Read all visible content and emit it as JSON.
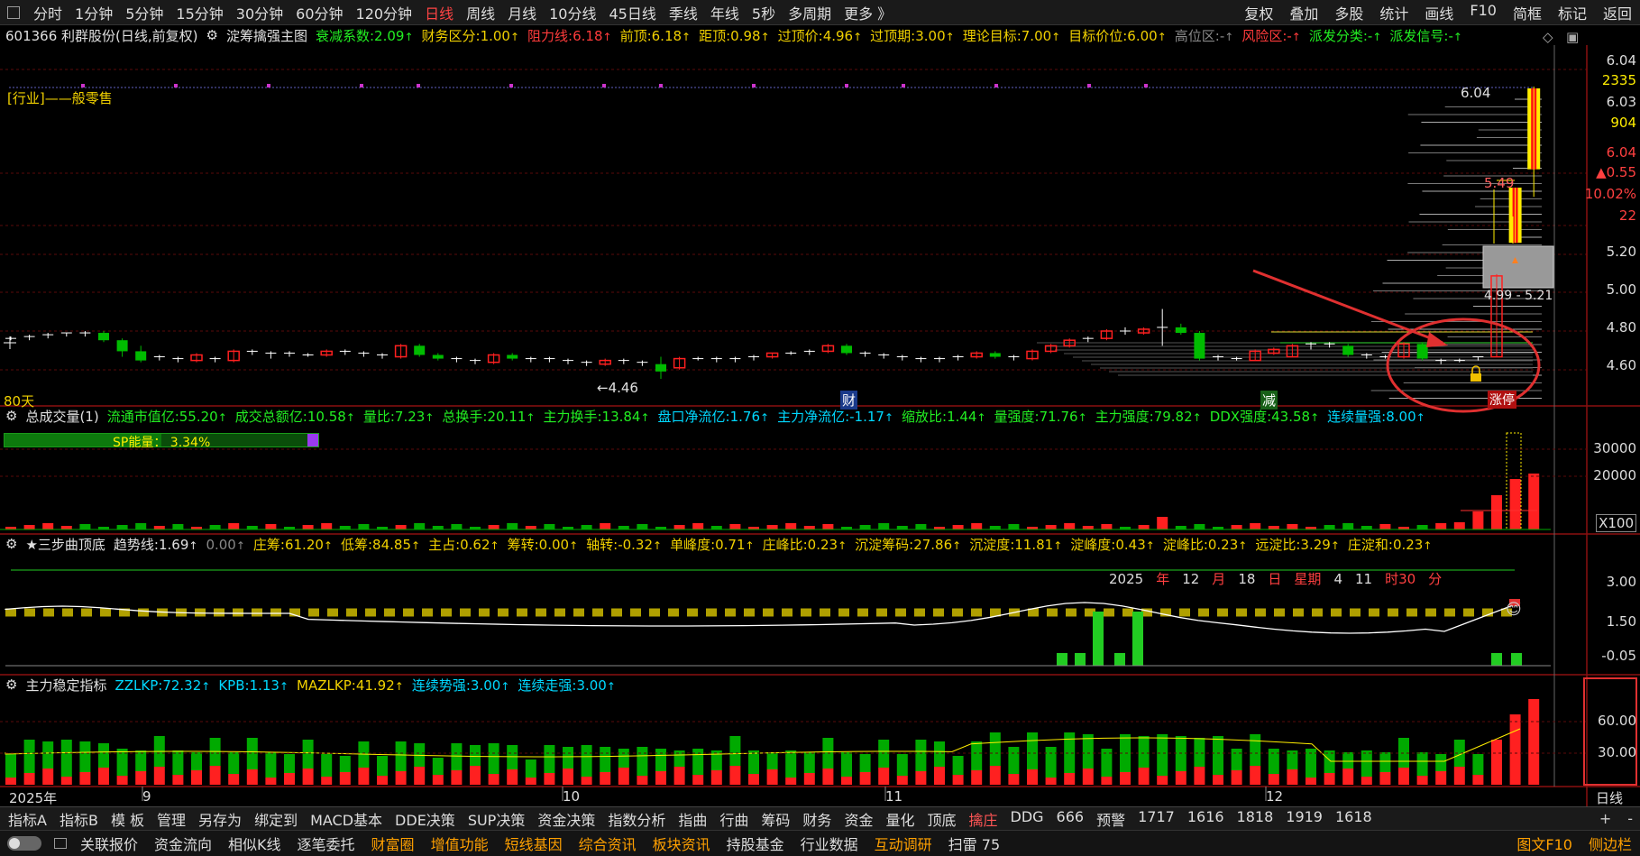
{
  "topbar": {
    "periods": [
      "分时",
      "1分钟",
      "5分钟",
      "15分钟",
      "30分钟",
      "60分钟",
      "120分钟",
      "日线",
      "周线",
      "月线",
      "10分线",
      "45日线",
      "季线",
      "年线",
      "5秒",
      "多周期",
      "更多 》"
    ],
    "active_period": "日线",
    "right_menu": [
      "复权",
      "叠加",
      "多股",
      "统计",
      "画线",
      "F10",
      "简框",
      "标记",
      "返回"
    ]
  },
  "header": {
    "stock": "601366 利群股份(日线,前复权)",
    "indicator": "淀筹擒强主图",
    "items": [
      {
        "label": "衰减系数:",
        "value": "2.09",
        "color": "g"
      },
      {
        "label": "财务区分:",
        "value": "1.00",
        "color": "y"
      },
      {
        "label": "阻力线:",
        "value": "6.18",
        "color": "r"
      },
      {
        "label": "前顶:",
        "value": "6.18",
        "color": "y"
      },
      {
        "label": "距顶:",
        "value": "0.98",
        "color": "y"
      },
      {
        "label": "过顶价:",
        "value": "4.96",
        "color": "y"
      },
      {
        "label": "过顶期:",
        "value": "3.00",
        "color": "y"
      },
      {
        "label": "理论目标:",
        "value": "7.00",
        "color": "y"
      },
      {
        "label": "目标价位:",
        "value": "6.00",
        "color": "y"
      },
      {
        "label": "高位区:",
        "value": "-",
        "color": "gy"
      },
      {
        "label": "风险区:",
        "value": "-",
        "color": "r"
      },
      {
        "label": "派发分类:",
        "value": "-",
        "color": "g"
      },
      {
        "label": "派发信号:",
        "value": "-",
        "color": "g"
      }
    ]
  },
  "main_chart": {
    "industry": "[行业]——般零售",
    "days_label": "80天",
    "low_marker": "←4.46",
    "high_marker": "6.04",
    "mid_marker": "5.49",
    "range_label": "4.99 - 5.21",
    "tags": [
      "财",
      "减",
      "涨停"
    ],
    "right_axis": [
      "6.04",
      "2335",
      "6.03",
      "904",
      "6.04",
      "▲0.55",
      "10.02%",
      "22",
      "5.20",
      "5.00",
      "4.80",
      "4.60"
    ]
  },
  "volume_panel": {
    "title": "总成交量(1)",
    "items": [
      {
        "label": "流通市值亿:",
        "value": "55.20",
        "color": "g"
      },
      {
        "label": "成交总额亿:",
        "value": "10.58",
        "color": "g"
      },
      {
        "label": "量比:",
        "value": "7.23",
        "color": "g"
      },
      {
        "label": "总换手:",
        "value": "20.11",
        "color": "g"
      },
      {
        "label": "主力换手:",
        "value": "13.84",
        "color": "g"
      },
      {
        "label": "盘口净流亿:",
        "value": "1.76",
        "color": "c"
      },
      {
        "label": "主力净流亿:",
        "value": "-1.17",
        "color": "c"
      },
      {
        "label": "缩放比:",
        "value": "1.44",
        "color": "g"
      },
      {
        "label": "量强度:",
        "value": "71.76",
        "color": "g"
      },
      {
        "label": "主力强度:",
        "value": "79.82",
        "color": "g"
      },
      {
        "label": "DDX强度:",
        "value": "43.58",
        "color": "g"
      },
      {
        "label": "连续量强:",
        "value": "8.00",
        "color": "c"
      }
    ],
    "sp_label": "SP能量：",
    "sp_value": "3.34%",
    "sp_fraction": 0.5,
    "axis": [
      "30000",
      "20000",
      "X100"
    ]
  },
  "sanbu_panel": {
    "title": "★三步曲顶底",
    "items": [
      {
        "label": "趋势线:",
        "value": "1.69",
        "color": "w"
      },
      {
        "label": "",
        "value": "0.00",
        "color": "gy"
      },
      {
        "label": "庄筹:",
        "value": "61.20",
        "color": "y"
      },
      {
        "label": "低筹:",
        "value": "84.85",
        "color": "y"
      },
      {
        "label": "主占:",
        "value": "0.62",
        "color": "y"
      },
      {
        "label": "筹转:",
        "value": "0.00",
        "color": "y"
      },
      {
        "label": "轴转:",
        "value": "-0.32",
        "color": "y"
      },
      {
        "label": "单峰度:",
        "value": "0.71",
        "color": "y"
      },
      {
        "label": "庄峰比:",
        "value": "0.23",
        "color": "y"
      },
      {
        "label": "沉淀筹码:",
        "value": "27.86",
        "color": "y"
      },
      {
        "label": "沉淀度:",
        "value": "11.81",
        "color": "y"
      },
      {
        "label": "淀峰度:",
        "value": "0.43",
        "color": "y"
      },
      {
        "label": "淀峰比:",
        "value": "0.23",
        "color": "y"
      },
      {
        "label": "远淀比:",
        "value": "3.29",
        "color": "y"
      },
      {
        "label": "庄淀和:",
        "value": "0.23",
        "color": "y"
      }
    ],
    "date_line": [
      "2025",
      "年",
      "12",
      "月",
      "18",
      "日",
      "星期",
      "4",
      "11",
      "时30",
      "分"
    ],
    "axis": [
      "3.00",
      "1.50",
      "-0.05"
    ]
  },
  "zhuli_panel": {
    "title": "主力稳定指标",
    "items": [
      {
        "label": "ZZLKP:",
        "value": "72.32",
        "color": "c"
      },
      {
        "label": "KPB:",
        "value": "1.13",
        "color": "c"
      },
      {
        "label": "MAZLKP:",
        "value": "41.92",
        "color": "y"
      },
      {
        "label": "连续势强:",
        "value": "3.00",
        "color": "c"
      },
      {
        "label": "连续走强:",
        "value": "3.00",
        "color": "c"
      }
    ],
    "axis": [
      "60.00",
      "30.00"
    ]
  },
  "time_axis": [
    "2025年",
    "9",
    "10",
    "11",
    "12"
  ],
  "right_bottom": "日线",
  "bottom_tabs": [
    "指标A",
    "指标B",
    "模 板",
    "管理",
    "另存为",
    "绑定到",
    "MACD基本",
    "DDE决策",
    "SUP决策",
    "资金决策",
    "指数分析",
    "指曲",
    "行曲",
    "筹码",
    "财务",
    "资金",
    "量化",
    "顶底",
    "擒庄",
    "DDG",
    "666",
    "预警",
    "1717",
    "1616",
    "1818",
    "1919",
    "1618"
  ],
  "bottom_tabs_active": "擒庄",
  "bottom_bar": [
    "关联报价",
    "资金流向",
    "相似K线",
    "逐笔委托",
    "财富圈",
    "增值功能",
    "短线基因",
    "综合资讯",
    "板块资讯",
    "持股基金",
    "行业数据",
    "互动调研",
    "扫雷 75"
  ],
  "bottom_bar_right": [
    "图文F10",
    "侧边栏"
  ],
  "colors": {
    "up": "#ff2020",
    "down": "#00bb00",
    "accent": "#ffee00",
    "bg": "#000000"
  },
  "chart_data": {
    "type": "candlestick",
    "candles": [
      [
        4.68,
        4.69,
        4.67,
        4.68
      ],
      [
        4.68,
        4.7,
        4.67,
        4.69
      ],
      [
        4.69,
        4.71,
        4.68,
        4.7
      ],
      [
        4.7,
        4.71,
        4.69,
        4.71
      ],
      [
        4.71,
        4.72,
        4.69,
        4.7
      ],
      [
        4.71,
        4.72,
        4.66,
        4.67
      ],
      [
        4.67,
        4.68,
        4.58,
        4.61
      ],
      [
        4.61,
        4.64,
        4.55,
        4.56
      ],
      [
        4.58,
        4.59,
        4.56,
        4.58
      ],
      [
        4.57,
        4.58,
        4.55,
        4.56
      ],
      [
        4.56,
        4.6,
        4.55,
        4.59
      ],
      [
        4.57,
        4.58,
        4.55,
        4.56
      ],
      [
        4.56,
        4.62,
        4.55,
        4.61
      ],
      [
        4.61,
        4.62,
        4.59,
        4.6
      ],
      [
        4.59,
        4.61,
        4.57,
        4.6
      ],
      [
        4.6,
        4.61,
        4.58,
        4.59
      ],
      [
        4.59,
        4.6,
        4.58,
        4.59
      ],
      [
        4.59,
        4.62,
        4.58,
        4.61
      ],
      [
        4.61,
        4.62,
        4.59,
        4.6
      ],
      [
        4.6,
        4.61,
        4.58,
        4.59
      ],
      [
        4.59,
        4.6,
        4.57,
        4.58
      ],
      [
        4.58,
        4.65,
        4.57,
        4.64
      ],
      [
        4.64,
        4.65,
        4.58,
        4.59
      ],
      [
        4.59,
        4.6,
        4.56,
        4.57
      ],
      [
        4.57,
        4.58,
        4.55,
        4.56
      ],
      [
        4.56,
        4.57,
        4.54,
        4.55
      ],
      [
        4.55,
        4.6,
        4.54,
        4.59
      ],
      [
        4.59,
        4.6,
        4.56,
        4.57
      ],
      [
        4.56,
        4.58,
        4.55,
        4.57
      ],
      [
        4.57,
        4.58,
        4.55,
        4.56
      ],
      [
        4.56,
        4.57,
        4.54,
        4.55
      ],
      [
        4.55,
        4.56,
        4.53,
        4.54
      ],
      [
        4.54,
        4.57,
        4.53,
        4.56
      ],
      [
        4.56,
        4.57,
        4.54,
        4.55
      ],
      [
        4.55,
        4.56,
        4.53,
        4.54
      ],
      [
        4.54,
        4.58,
        4.46,
        4.5
      ],
      [
        4.52,
        4.58,
        4.51,
        4.57
      ],
      [
        4.57,
        4.58,
        4.56,
        4.57
      ],
      [
        4.57,
        4.58,
        4.55,
        4.56
      ],
      [
        4.56,
        4.58,
        4.55,
        4.57
      ],
      [
        4.57,
        4.59,
        4.56,
        4.58
      ],
      [
        4.58,
        4.6,
        4.57,
        4.6
      ],
      [
        4.6,
        4.61,
        4.59,
        4.6
      ],
      [
        4.6,
        4.62,
        4.59,
        4.61
      ],
      [
        4.61,
        4.65,
        4.6,
        4.64
      ],
      [
        4.64,
        4.65,
        4.59,
        4.6
      ],
      [
        4.6,
        4.61,
        4.58,
        4.59
      ],
      [
        4.59,
        4.6,
        4.57,
        4.58
      ],
      [
        4.58,
        4.59,
        4.56,
        4.57
      ],
      [
        4.57,
        4.58,
        4.55,
        4.56
      ],
      [
        4.56,
        4.58,
        4.55,
        4.57
      ],
      [
        4.57,
        4.59,
        4.56,
        4.58
      ],
      [
        4.58,
        4.61,
        4.57,
        4.6
      ],
      [
        4.6,
        4.61,
        4.57,
        4.58
      ],
      [
        4.58,
        4.59,
        4.56,
        4.57
      ],
      [
        4.57,
        4.62,
        4.56,
        4.61
      ],
      [
        4.61,
        4.65,
        4.6,
        4.64
      ],
      [
        4.64,
        4.68,
        4.63,
        4.67
      ],
      [
        4.67,
        4.69,
        4.66,
        4.68
      ],
      [
        4.68,
        4.73,
        4.67,
        4.72
      ],
      [
        4.72,
        4.74,
        4.7,
        4.71
      ],
      [
        4.71,
        4.74,
        4.7,
        4.73
      ],
      [
        4.73,
        4.84,
        4.64,
        4.74
      ],
      [
        4.74,
        4.76,
        4.7,
        4.71
      ],
      [
        4.71,
        4.72,
        4.56,
        4.57
      ],
      [
        4.58,
        4.59,
        4.56,
        4.57
      ],
      [
        4.57,
        4.58,
        4.56,
        4.57
      ],
      [
        4.56,
        4.62,
        4.56,
        4.61
      ],
      [
        4.6,
        4.63,
        4.59,
        4.62
      ],
      [
        4.58,
        4.65,
        4.58,
        4.64
      ],
      [
        4.64,
        4.66,
        4.62,
        4.65
      ],
      [
        4.65,
        4.66,
        4.63,
        4.64
      ],
      [
        4.64,
        4.65,
        4.58,
        4.59
      ],
      [
        4.59,
        4.6,
        4.57,
        4.58
      ],
      [
        4.58,
        4.59,
        4.57,
        4.58
      ],
      [
        4.58,
        4.66,
        4.57,
        4.65
      ],
      [
        4.65,
        4.66,
        4.56,
        4.57
      ],
      [
        4.55,
        4.57,
        4.54,
        4.56
      ],
      [
        4.56,
        4.57,
        4.55,
        4.56
      ],
      [
        4.57,
        4.58,
        4.56,
        4.58
      ],
      [
        4.58,
        5.03,
        4.58,
        5.02
      ],
      [
        5.2,
        5.5,
        5.2,
        5.5
      ],
      [
        5.6,
        6.05,
        5.45,
        6.04
      ]
    ]
  }
}
